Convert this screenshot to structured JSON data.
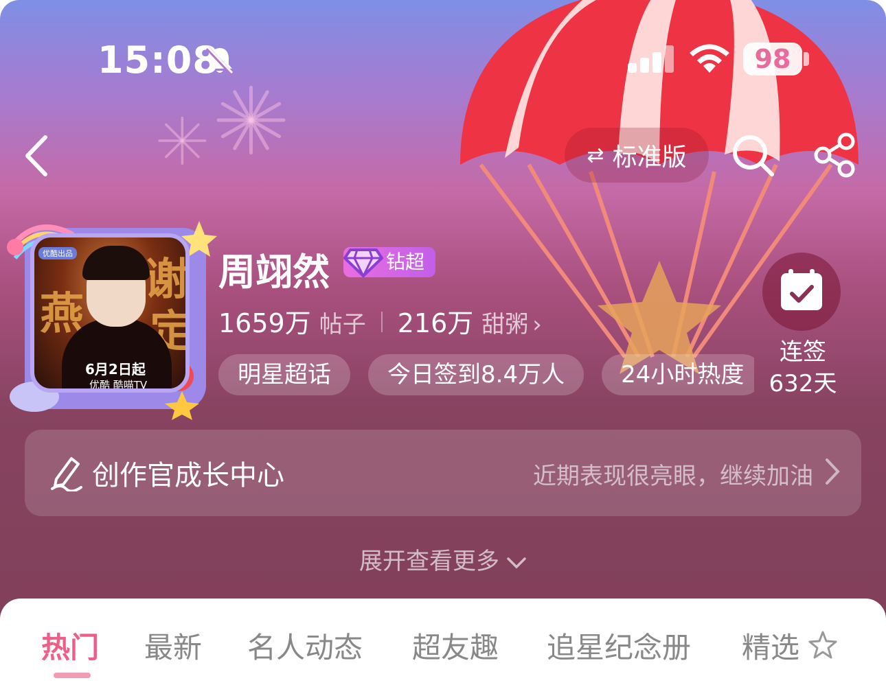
{
  "status_bar": {
    "time": "15:08",
    "battery": "98"
  },
  "nav": {
    "edition_label": "标准版"
  },
  "profile": {
    "name": "周翊然",
    "badge": "钻超",
    "posts_count": "1659万",
    "posts_label": "帖子",
    "fans_count": "216万",
    "fans_label": "甜粥",
    "tags": [
      "明星超话",
      "今日签到8.4万人",
      "24小时热度"
    ]
  },
  "avatar_poster": {
    "tag": "优酷出品",
    "date": "6月2日起",
    "brand": "优酷 酷喵TV",
    "calligraphy": [
      "燕",
      "谢",
      "定"
    ]
  },
  "checkin": {
    "label": "连签",
    "days": "632天"
  },
  "creator": {
    "title": "创作官成长中心",
    "hint": "近期表现很亮眼，继续加油"
  },
  "expand": {
    "label": "展开查看更多"
  },
  "tabs": [
    "热门",
    "最新",
    "名人动态",
    "超友趣",
    "追星纪念册",
    "精选"
  ],
  "colors": {
    "accent": "#ee5f87",
    "badge": "#c25fe8",
    "bg_top": "#7f8fe6",
    "bg_bottom": "#7f3f58"
  }
}
